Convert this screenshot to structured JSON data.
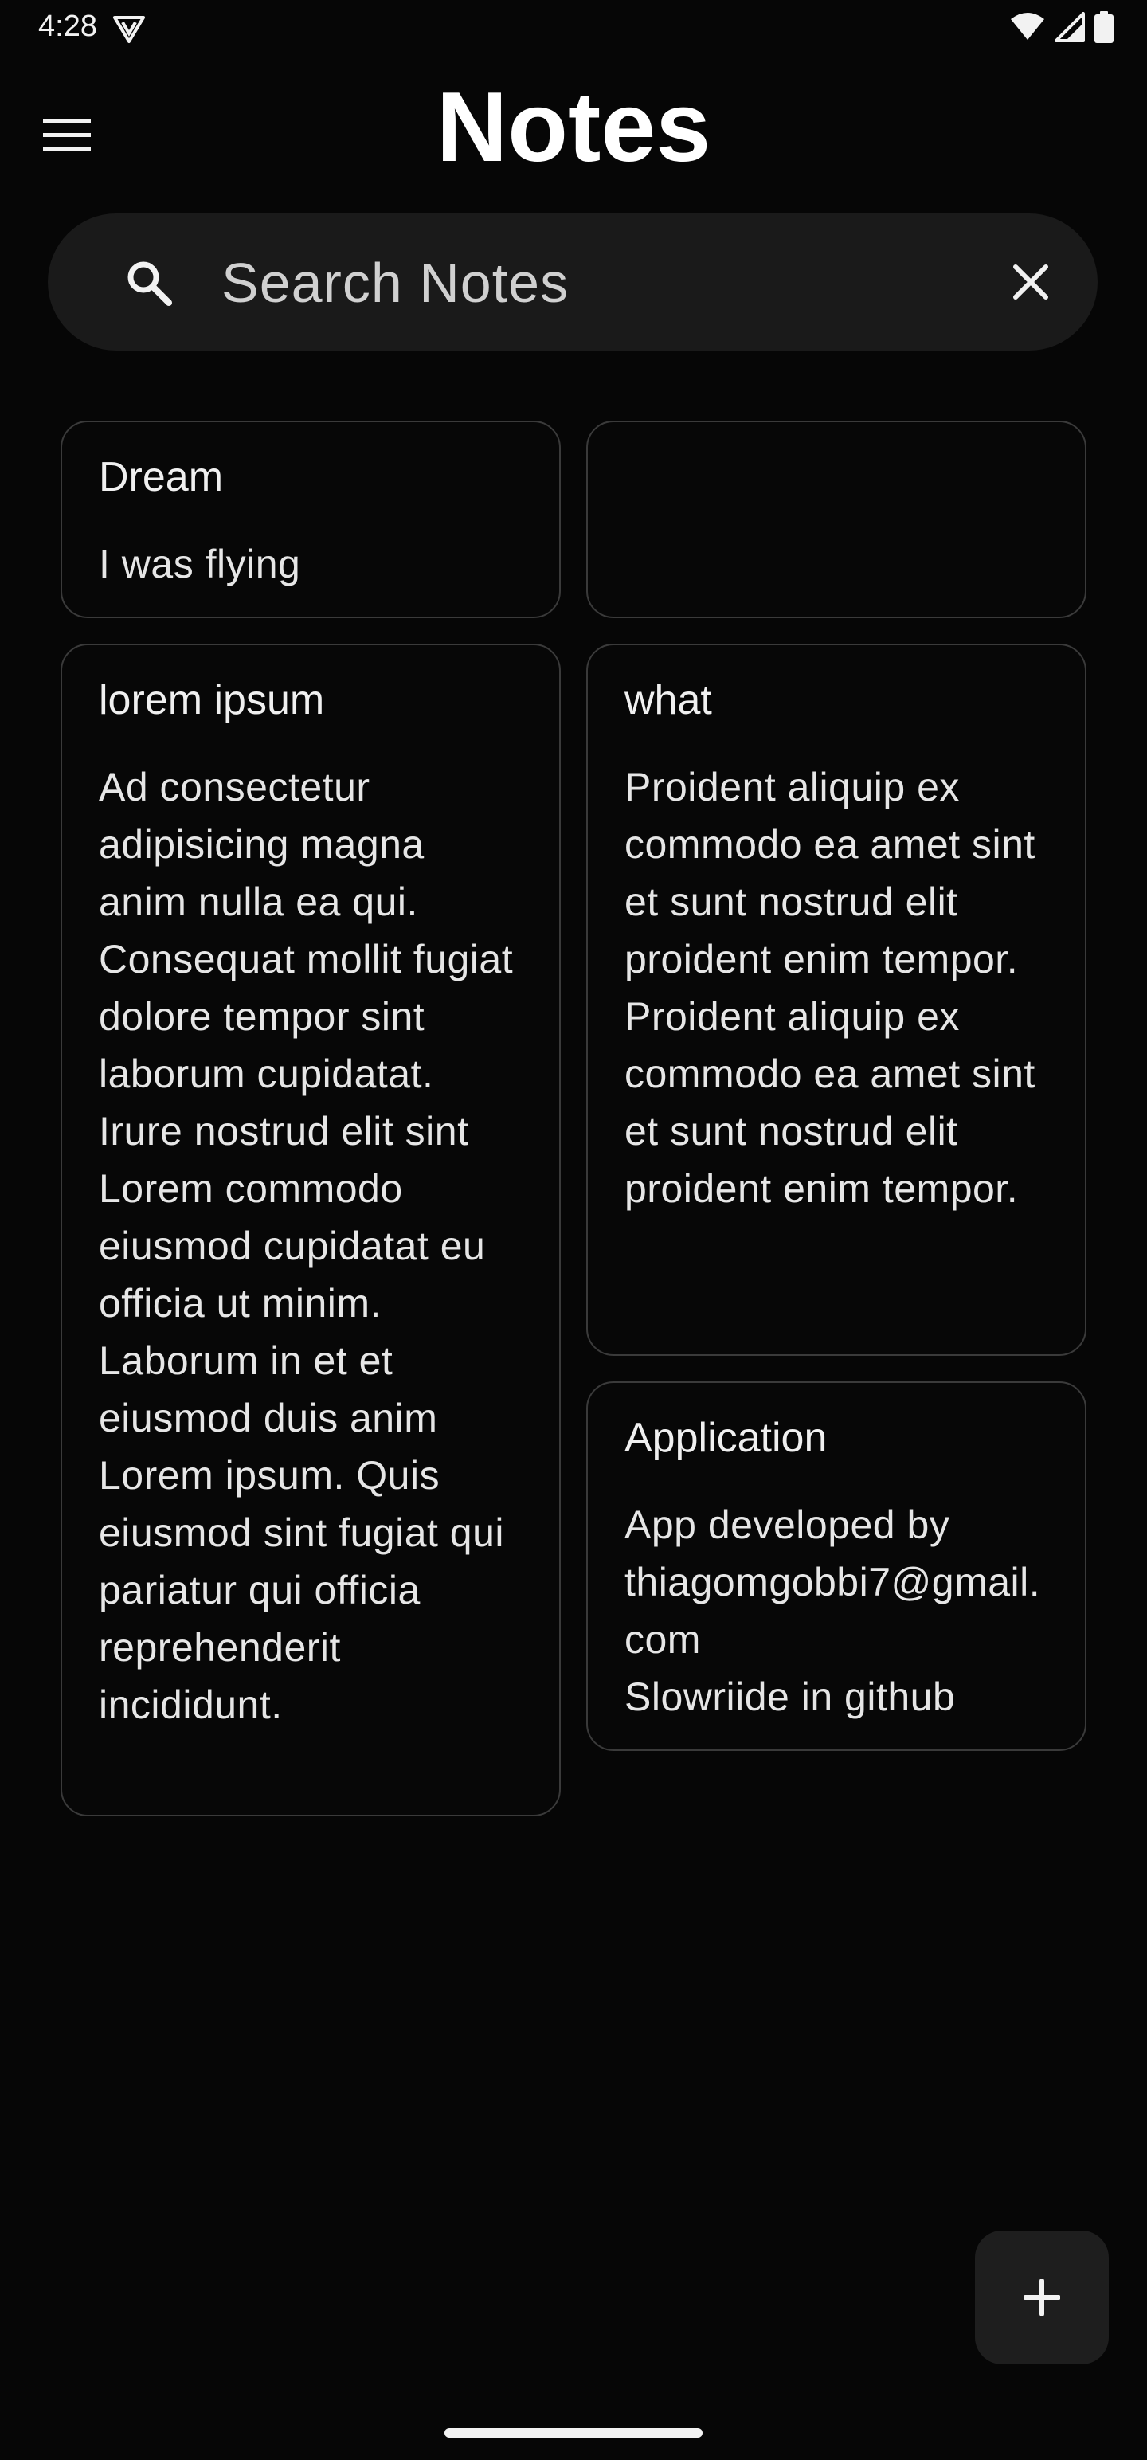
{
  "status_bar": {
    "time": "4:28",
    "icons": [
      "vpn-icon",
      "wifi-icon",
      "cellular-signal-icon",
      "battery-icon"
    ]
  },
  "header": {
    "title": "Notes",
    "menu_icon": "hamburger-menu-icon"
  },
  "search": {
    "placeholder": "Search Notes",
    "value": "",
    "search_icon": "search-icon",
    "clear_icon": "close-icon"
  },
  "notes": [
    {
      "title": "Dream",
      "body": "I was flying"
    },
    {
      "title": "",
      "body": ""
    },
    {
      "title": "lorem ipsum",
      "body": "Ad consectetur adipisicing magna anim nulla ea qui. Consequat mollit fugiat dolore tempor sint laborum cupidatat. Irure nostrud elit sint Lorem commodo eiusmod cupidatat eu officia ut minim. Laborum in et et eiusmod duis anim Lorem ipsum. Quis eiusmod sint fugiat qui pariatur qui officia reprehenderit incididunt."
    },
    {
      "title": "what",
      "body": "Proident aliquip ex commodo ea amet sint et sunt nostrud elit proident enim tempor.\nProident aliquip ex commodo ea amet sint et sunt nostrud elit proident enim tempor."
    },
    {
      "title": "Application",
      "body": "App developed by thiagomgobbi7@gmail.com\nSlowriide in github"
    }
  ],
  "fab": {
    "icon": "plus-icon"
  },
  "colors": {
    "background": "#060606",
    "surface": "#1a1a1a",
    "card_border": "#3a3a3a",
    "text": "#ececec"
  }
}
